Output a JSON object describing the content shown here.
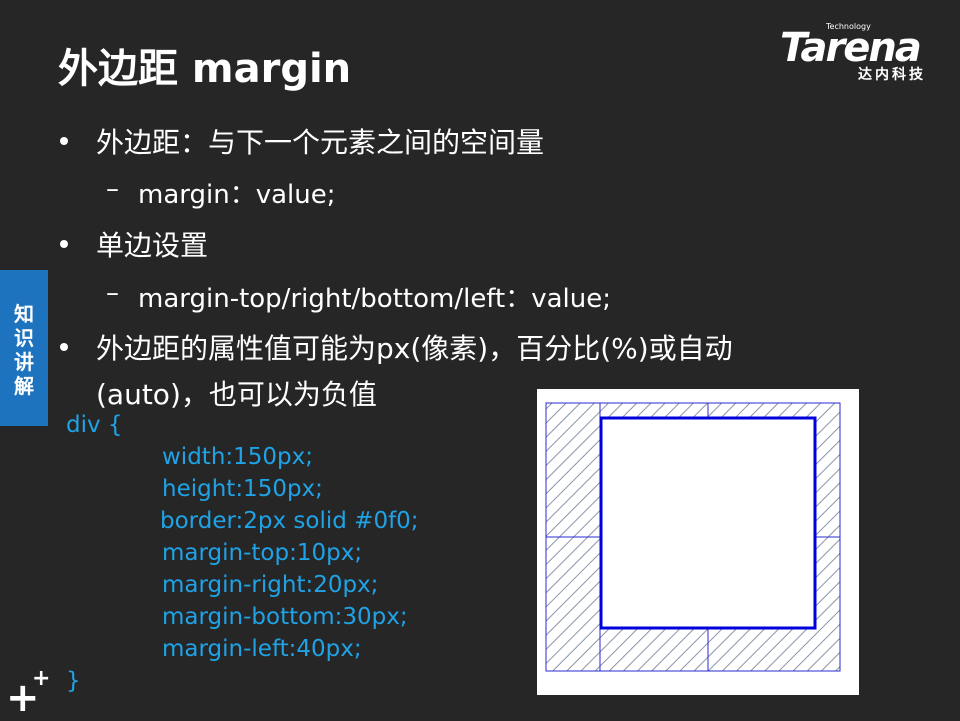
{
  "slide": {
    "title": "外边距 margin",
    "logo": {
      "brand": "Tarena",
      "tagline": "Technology",
      "chinese": "达内科技"
    },
    "side_tab": [
      "知",
      "识",
      "讲",
      "解"
    ],
    "bullets": [
      {
        "text": "外边距：与下一个元素之间的空间量"
      },
      {
        "sub": "margin：value;"
      },
      {
        "text": "单边设置"
      },
      {
        "sub": "margin-top/right/bottom/left：value;"
      },
      {
        "text": "外边距的属性值可能为px(像素)，百分比(%)或自动"
      },
      {
        "text_cont": "(auto)，也可以为负值"
      }
    ],
    "code": [
      "div  {",
      "width:150px;",
      "height:150px;",
      "border:2px solid #0f0;",
      "margin-top:10px;",
      "margin-right:20px;",
      "margin-bottom:30px;",
      "margin-left:40px;",
      "}"
    ]
  },
  "colors": {
    "background": "#262626",
    "code_text": "#1fa3e6",
    "side_tab": "#1e73be",
    "box_border": "#0000dd"
  }
}
